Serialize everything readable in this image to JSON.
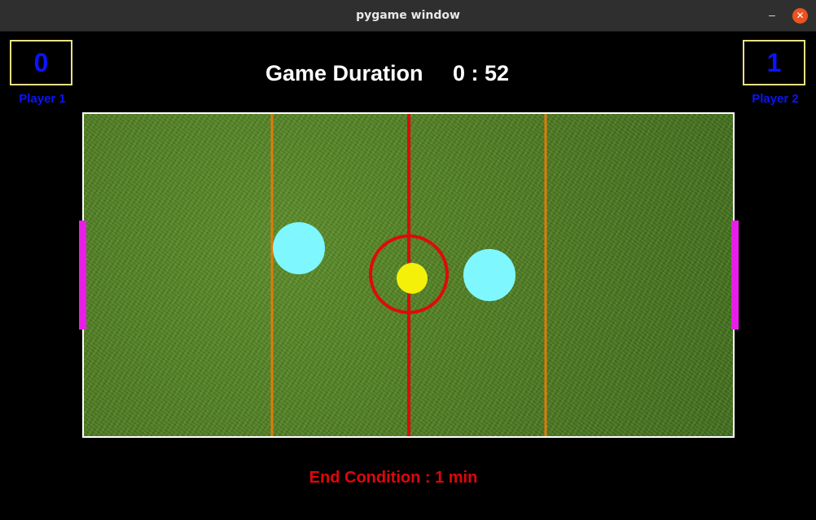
{
  "window": {
    "title": "pygame window",
    "minimize_glyph": "–",
    "close_glyph": "✕"
  },
  "player1": {
    "score": "0",
    "label": "Player 1"
  },
  "player2": {
    "score": "1",
    "label": "Player 2"
  },
  "duration": {
    "label": "Game Duration",
    "time": "0 : 52"
  },
  "end_condition": "End Condition :  1 min",
  "colors": {
    "score_text": "#0a14ff",
    "score_border": "#e8e08a",
    "field_border": "#ffffff",
    "quarter_lines": "#e07b0a",
    "center_line": "#e00a0a",
    "ball": "#f5f00a",
    "strikers": "#7ef7ff",
    "goals": "#e81ee8",
    "end_condition": "#e0060b"
  }
}
